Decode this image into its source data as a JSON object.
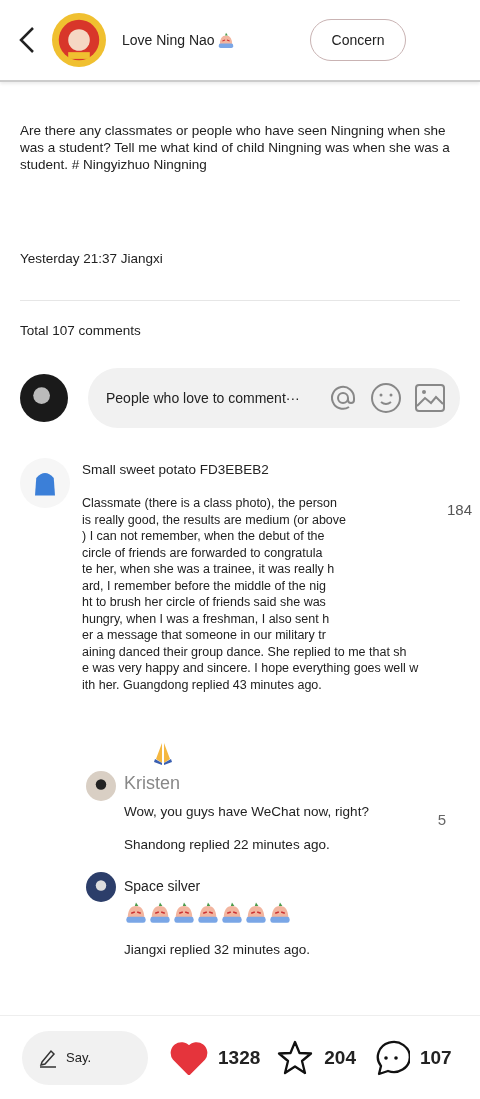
{
  "header": {
    "author": "Love Ning Nao",
    "follow_button": "Concern"
  },
  "post": {
    "text": "Are there any classmates or people who have seen Ningning when she was a student? Tell me what kind of child Ningning was when she was a student. # Ningyizhuo Ningning",
    "meta": "Yesterday 21:37 Jiangxi"
  },
  "comments_total": "Total 107 comments",
  "comment_input": {
    "placeholder": "People who love to comment···"
  },
  "comments": [
    {
      "author": "Small sweet potato FD3EBEB2",
      "text": "Classmate (there is a class photo), the person\nis really good, the results are medium (or above\n) I can not remember, when the debut of the\ncircle of friends are forwarded to congratula\nte her, when she was a trainee, it was really h\nard, I remember before the middle of the nig\nht to brush her circle of friends said she was\nhungry, when I was a freshman, I also sent h\ner a message that someone in our military tr\naining danced their group dance. She replied to me that sh\ne was very happy and sincere. I hope everything goes well w\nith her. Guangdong replied 43 minutes ago.",
      "likes": "184",
      "replies": [
        {
          "author": "Kristen",
          "text": "Wow, you guys have WeChat now, right?",
          "meta": "Shandong replied 22 minutes ago.",
          "likes": "5",
          "kind": "text"
        },
        {
          "author": "Space silver",
          "meta": "Jiangxi replied 32 minutes ago.",
          "kind": "stickers"
        }
      ]
    }
  ],
  "bottom_bar": {
    "say_placeholder": "Say.",
    "likes": "1328",
    "liked": true,
    "stars": "204",
    "starred": false,
    "comments": "107"
  }
}
